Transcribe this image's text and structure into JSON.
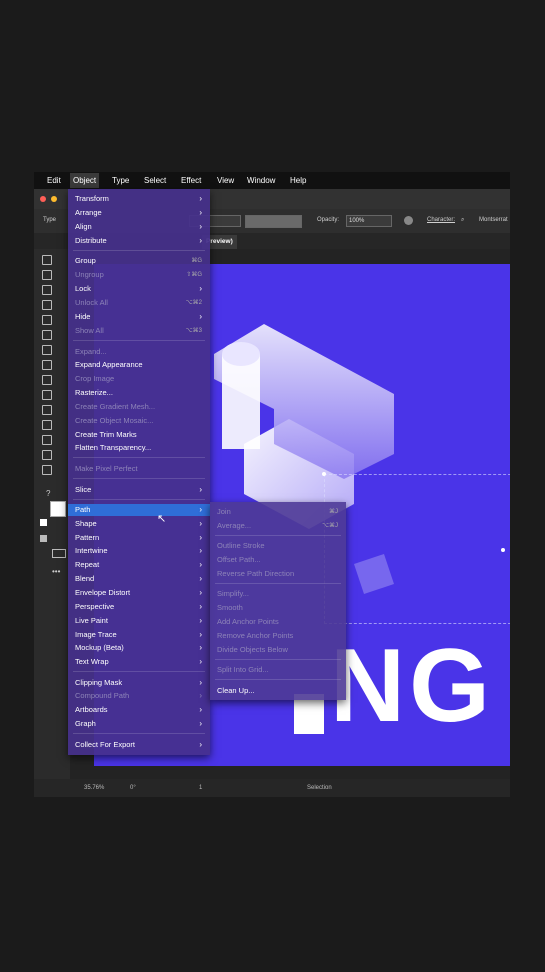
{
  "menubar": {
    "items": [
      "Edit",
      "Object",
      "Type",
      "Select",
      "Effect",
      "View",
      "Window",
      "Help"
    ],
    "active": "Object"
  },
  "control_bar": {
    "type_label": "Type",
    "opacity_label": "Opacity:",
    "opacity_value": "100%",
    "character_label": "Character:",
    "font_value": "Montserrat"
  },
  "document_tab": {
    "label": "Preview)"
  },
  "status_bar": {
    "zoom": "35.76%",
    "rotation": "0°",
    "artboard_number": "1",
    "tool": "Selection"
  },
  "artboard_text": {
    "word_fragment": "NG"
  },
  "object_menu": {
    "items": [
      {
        "label": "Transform",
        "submenu": true
      },
      {
        "label": "Arrange",
        "submenu": true
      },
      {
        "label": "Align",
        "submenu": true
      },
      {
        "label": "Distribute",
        "submenu": true
      },
      {
        "label": "Group",
        "shortcut": "⌘G"
      },
      {
        "label": "Ungroup",
        "disabled": true,
        "shortcut": "⇧⌘G"
      },
      {
        "label": "Lock",
        "submenu": true
      },
      {
        "label": "Unlock All",
        "disabled": true,
        "shortcut": "⌥⌘2"
      },
      {
        "label": "Hide",
        "submenu": true
      },
      {
        "label": "Show All",
        "disabled": true,
        "shortcut": "⌥⌘3"
      },
      {
        "label": "Expand...",
        "disabled": true
      },
      {
        "label": "Expand Appearance"
      },
      {
        "label": "Crop Image",
        "disabled": true
      },
      {
        "label": "Rasterize..."
      },
      {
        "label": "Create Gradient Mesh...",
        "disabled": true
      },
      {
        "label": "Create Object Mosaic...",
        "disabled": true
      },
      {
        "label": "Create Trim Marks"
      },
      {
        "label": "Flatten Transparency..."
      },
      {
        "label": "Make Pixel Perfect",
        "disabled": true
      },
      {
        "label": "Slice",
        "submenu": true
      },
      {
        "label": "Path",
        "submenu": true,
        "highlighted": true
      },
      {
        "label": "Shape",
        "submenu": true
      },
      {
        "label": "Pattern",
        "submenu": true
      },
      {
        "label": "Intertwine",
        "submenu": true
      },
      {
        "label": "Repeat",
        "submenu": true
      },
      {
        "label": "Blend",
        "submenu": true
      },
      {
        "label": "Envelope Distort",
        "submenu": true
      },
      {
        "label": "Perspective",
        "submenu": true
      },
      {
        "label": "Live Paint",
        "submenu": true
      },
      {
        "label": "Image Trace",
        "submenu": true
      },
      {
        "label": "Mockup (Beta)",
        "submenu": true
      },
      {
        "label": "Text Wrap",
        "submenu": true
      },
      {
        "label": "Clipping Mask",
        "submenu": true
      },
      {
        "label": "Compound Path",
        "submenu": true,
        "disabled": true
      },
      {
        "label": "Artboards",
        "submenu": true
      },
      {
        "label": "Graph",
        "submenu": true
      },
      {
        "label": "Collect For Export",
        "submenu": true
      }
    ]
  },
  "path_submenu": {
    "items": [
      {
        "label": "Join",
        "disabled": true,
        "shortcut": "⌘J"
      },
      {
        "label": "Average...",
        "disabled": true,
        "shortcut": "⌥⌘J"
      },
      {
        "label": "Outline Stroke",
        "disabled": true
      },
      {
        "label": "Offset Path...",
        "disabled": true
      },
      {
        "label": "Reverse Path Direction",
        "disabled": true
      },
      {
        "label": "Simplify...",
        "disabled": true
      },
      {
        "label": "Smooth",
        "disabled": true
      },
      {
        "label": "Add Anchor Points",
        "disabled": true
      },
      {
        "label": "Remove Anchor Points",
        "disabled": true
      },
      {
        "label": "Divide Objects Below",
        "disabled": true
      },
      {
        "label": "Split Into Grid...",
        "disabled": true
      },
      {
        "label": "Clean Up..."
      }
    ]
  },
  "colors": {
    "artboard": "#4a34e8",
    "menu_bg": "#46308c",
    "highlight": "#2f6ed8"
  }
}
